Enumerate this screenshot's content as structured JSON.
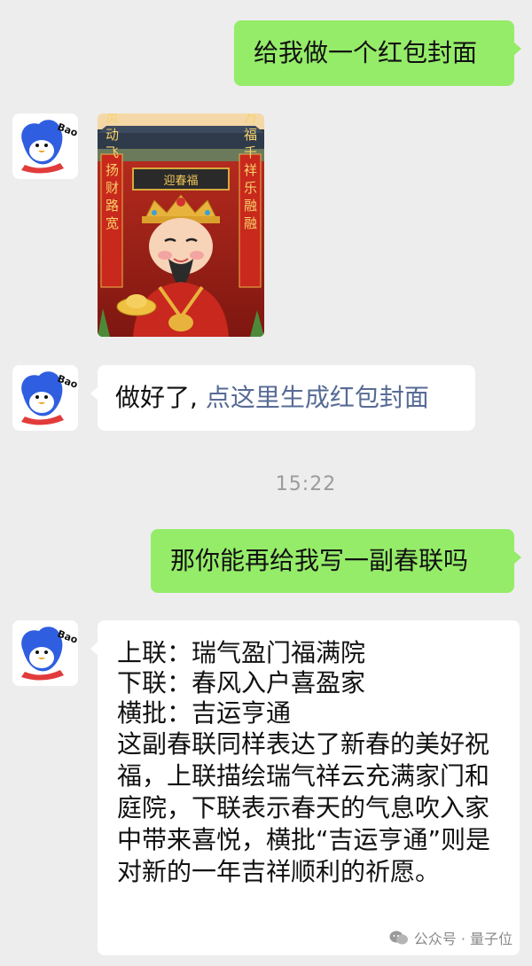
{
  "colors": {
    "background": "#ededed",
    "outgoing_bubble": "#95ec69",
    "incoming_bubble": "#ffffff",
    "link": "#576b95",
    "timestamp": "#9b9b9b"
  },
  "contact": {
    "avatar_icon": "bao-penguin-avatar",
    "avatar_text": "Bao"
  },
  "messages": {
    "m1": {
      "text": "给我做一个红包封面"
    },
    "m2": {
      "type": "image",
      "sign_top": "迎春福",
      "couplet_left": "灵动飞扬财路宽",
      "couplet_right": "万福千祥乐融融"
    },
    "m3": {
      "text_plain": "做好了, ",
      "link_text": "点这里生成红包封面"
    },
    "m4": {
      "text": "那你能再给我写一副春联吗"
    },
    "m5": {
      "line1": "上联：瑞气盈门福满院",
      "line2": "下联：春风入户喜盈家",
      "line3": "横批：吉运亨通",
      "paragraph": "这副春联同样表达了新春的美好祝福，上联描绘瑞气祥云充满家门和庭院，下联表示春天的气息吹入家中带来喜悦，横批“吉运亨通”则是对新的一年吉祥顺利的祈愿。"
    }
  },
  "timestamp": "15:22",
  "watermark": {
    "icon": "wechat-official-account-icon",
    "text": "公众号 · 量子位"
  }
}
